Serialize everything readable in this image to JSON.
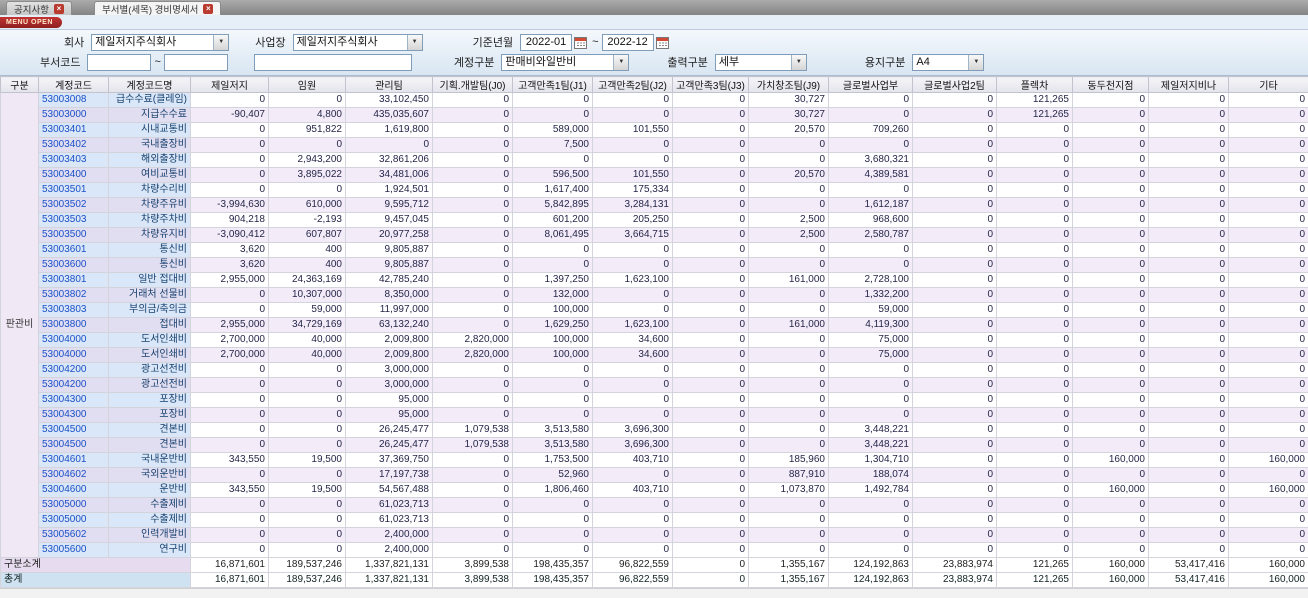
{
  "tabs": [
    {
      "label": "공지사항"
    },
    {
      "label": "부서별(세목) 경비명세서"
    }
  ],
  "menu_open_label": "MENU OPEN",
  "filters": {
    "company_label": "회사",
    "company_value": "제일저지주식회사",
    "site_label": "사업장",
    "site_value": "제일저지주식회사",
    "period_label": "기준년월",
    "period_from": "2022-01",
    "period_to": "2022-12",
    "range_separator": "~",
    "dept_code_label": "부서코드",
    "dept_from": "",
    "dept_to": "",
    "dept_name": "",
    "account_label": "계정구분",
    "account_value": "판매비와일반비",
    "output_label": "출력구분",
    "output_value": "세부",
    "paper_label": "용지구분",
    "paper_value": "A4"
  },
  "icons": {
    "close": "×",
    "dropdown_arrow": "▼",
    "calendar": "calendar-icon"
  },
  "colors": {
    "tab_close_red": "#b93a2e",
    "menu_open_red": "#8e1f1f",
    "code_blue": "#1a50c8",
    "stripe_lavender": "#f3ecf8",
    "code_bg_blue": "#d9e7f8",
    "total_row_blue": "#cfe2f2"
  },
  "table": {
    "group_label": "판관비",
    "headers": [
      "구분",
      "계정코드",
      "계정코드명",
      "제일저지",
      "임원",
      "관리팀",
      "기획.개발팀(J0)",
      "고객만족1팀(J1)",
      "고객만족2팀(J2)",
      "고객만족3팀(J3)",
      "가치창조팀(J9)",
      "글로벌사업부",
      "글로벌사업2팀",
      "플렉차",
      "동두천지점",
      "제일저지비나",
      "기타"
    ],
    "rows": [
      {
        "code": "53003008",
        "name": "급수수료(클레임)",
        "values": [
          "0",
          "0",
          "33,102,450",
          "0",
          "0",
          "0",
          "0",
          "30,727",
          "0",
          "0",
          "121,265",
          "0",
          "0",
          "0"
        ]
      },
      {
        "code": "53003000",
        "name": "지급수수료",
        "values": [
          "-90,407",
          "4,800",
          "435,035,607",
          "0",
          "0",
          "0",
          "0",
          "30,727",
          "0",
          "0",
          "121,265",
          "0",
          "0",
          "0"
        ]
      },
      {
        "code": "53003401",
        "name": "시내교통비",
        "values": [
          "0",
          "951,822",
          "1,619,800",
          "0",
          "589,000",
          "101,550",
          "0",
          "20,570",
          "709,260",
          "0",
          "0",
          "0",
          "0",
          "0"
        ]
      },
      {
        "code": "53003402",
        "name": "국내출장비",
        "values": [
          "0",
          "0",
          "0",
          "0",
          "7,500",
          "0",
          "0",
          "0",
          "0",
          "0",
          "0",
          "0",
          "0",
          "0"
        ]
      },
      {
        "code": "53003403",
        "name": "해외출장비",
        "values": [
          "0",
          "2,943,200",
          "32,861,206",
          "0",
          "0",
          "0",
          "0",
          "0",
          "3,680,321",
          "0",
          "0",
          "0",
          "0",
          "0"
        ]
      },
      {
        "code": "53003400",
        "name": "여비교통비",
        "values": [
          "0",
          "3,895,022",
          "34,481,006",
          "0",
          "596,500",
          "101,550",
          "0",
          "20,570",
          "4,389,581",
          "0",
          "0",
          "0",
          "0",
          "0"
        ]
      },
      {
        "code": "53003501",
        "name": "차량수리비",
        "values": [
          "0",
          "0",
          "1,924,501",
          "0",
          "1,617,400",
          "175,334",
          "0",
          "0",
          "0",
          "0",
          "0",
          "0",
          "0",
          "0"
        ]
      },
      {
        "code": "53003502",
        "name": "차량주유비",
        "values": [
          "-3,994,630",
          "610,000",
          "9,595,712",
          "0",
          "5,842,895",
          "3,284,131",
          "0",
          "0",
          "1,612,187",
          "0",
          "0",
          "0",
          "0",
          "0"
        ]
      },
      {
        "code": "53003503",
        "name": "차량주차비",
        "values": [
          "904,218",
          "-2,193",
          "9,457,045",
          "0",
          "601,200",
          "205,250",
          "0",
          "2,500",
          "968,600",
          "0",
          "0",
          "0",
          "0",
          "0"
        ]
      },
      {
        "code": "53003500",
        "name": "차량유지비",
        "values": [
          "-3,090,412",
          "607,807",
          "20,977,258",
          "0",
          "8,061,495",
          "3,664,715",
          "0",
          "2,500",
          "2,580,787",
          "0",
          "0",
          "0",
          "0",
          "0"
        ]
      },
      {
        "code": "53003601",
        "name": "통신비",
        "values": [
          "3,620",
          "400",
          "9,805,887",
          "0",
          "0",
          "0",
          "0",
          "0",
          "0",
          "0",
          "0",
          "0",
          "0",
          "0"
        ]
      },
      {
        "code": "53003600",
        "name": "통신비",
        "values": [
          "3,620",
          "400",
          "9,805,887",
          "0",
          "0",
          "0",
          "0",
          "0",
          "0",
          "0",
          "0",
          "0",
          "0",
          "0"
        ]
      },
      {
        "code": "53003801",
        "name": "일반 접대비",
        "values": [
          "2,955,000",
          "24,363,169",
          "42,785,240",
          "0",
          "1,397,250",
          "1,623,100",
          "0",
          "161,000",
          "2,728,100",
          "0",
          "0",
          "0",
          "0",
          "0"
        ]
      },
      {
        "code": "53003802",
        "name": "거래처 선물비",
        "values": [
          "0",
          "10,307,000",
          "8,350,000",
          "0",
          "132,000",
          "0",
          "0",
          "0",
          "1,332,200",
          "0",
          "0",
          "0",
          "0",
          "0"
        ]
      },
      {
        "code": "53003803",
        "name": "부의금/축의금",
        "values": [
          "0",
          "59,000",
          "11,997,000",
          "0",
          "100,000",
          "0",
          "0",
          "0",
          "59,000",
          "0",
          "0",
          "0",
          "0",
          "0"
        ]
      },
      {
        "code": "53003800",
        "name": "접대비",
        "values": [
          "2,955,000",
          "34,729,169",
          "63,132,240",
          "0",
          "1,629,250",
          "1,623,100",
          "0",
          "161,000",
          "4,119,300",
          "0",
          "0",
          "0",
          "0",
          "0"
        ]
      },
      {
        "code": "53004000",
        "name": "도서인쇄비",
        "values": [
          "2,700,000",
          "40,000",
          "2,009,800",
          "2,820,000",
          "100,000",
          "34,600",
          "0",
          "0",
          "75,000",
          "0",
          "0",
          "0",
          "0",
          "0"
        ]
      },
      {
        "code": "53004000",
        "name": "도서인쇄비",
        "values": [
          "2,700,000",
          "40,000",
          "2,009,800",
          "2,820,000",
          "100,000",
          "34,600",
          "0",
          "0",
          "75,000",
          "0",
          "0",
          "0",
          "0",
          "0"
        ]
      },
      {
        "code": "53004200",
        "name": "광고선전비",
        "values": [
          "0",
          "0",
          "3,000,000",
          "0",
          "0",
          "0",
          "0",
          "0",
          "0",
          "0",
          "0",
          "0",
          "0",
          "0"
        ]
      },
      {
        "code": "53004200",
        "name": "광고선전비",
        "values": [
          "0",
          "0",
          "3,000,000",
          "0",
          "0",
          "0",
          "0",
          "0",
          "0",
          "0",
          "0",
          "0",
          "0",
          "0"
        ]
      },
      {
        "code": "53004300",
        "name": "포장비",
        "values": [
          "0",
          "0",
          "95,000",
          "0",
          "0",
          "0",
          "0",
          "0",
          "0",
          "0",
          "0",
          "0",
          "0",
          "0"
        ]
      },
      {
        "code": "53004300",
        "name": "포장비",
        "values": [
          "0",
          "0",
          "95,000",
          "0",
          "0",
          "0",
          "0",
          "0",
          "0",
          "0",
          "0",
          "0",
          "0",
          "0"
        ]
      },
      {
        "code": "53004500",
        "name": "견본비",
        "values": [
          "0",
          "0",
          "26,245,477",
          "1,079,538",
          "3,513,580",
          "3,696,300",
          "0",
          "0",
          "3,448,221",
          "0",
          "0",
          "0",
          "0",
          "0"
        ]
      },
      {
        "code": "53004500",
        "name": "견본비",
        "values": [
          "0",
          "0",
          "26,245,477",
          "1,079,538",
          "3,513,580",
          "3,696,300",
          "0",
          "0",
          "3,448,221",
          "0",
          "0",
          "0",
          "0",
          "0"
        ]
      },
      {
        "code": "53004601",
        "name": "국내운반비",
        "values": [
          "343,550",
          "19,500",
          "37,369,750",
          "0",
          "1,753,500",
          "403,710",
          "0",
          "185,960",
          "1,304,710",
          "0",
          "0",
          "160,000",
          "0",
          "160,000"
        ]
      },
      {
        "code": "53004602",
        "name": "국외운반비",
        "values": [
          "0",
          "0",
          "17,197,738",
          "0",
          "52,960",
          "0",
          "0",
          "887,910",
          "188,074",
          "0",
          "0",
          "0",
          "0",
          "0"
        ]
      },
      {
        "code": "53004600",
        "name": "운반비",
        "values": [
          "343,550",
          "19,500",
          "54,567,488",
          "0",
          "1,806,460",
          "403,710",
          "0",
          "1,073,870",
          "1,492,784",
          "0",
          "0",
          "160,000",
          "0",
          "160,000"
        ]
      },
      {
        "code": "53005000",
        "name": "수출제비",
        "values": [
          "0",
          "0",
          "61,023,713",
          "0",
          "0",
          "0",
          "0",
          "0",
          "0",
          "0",
          "0",
          "0",
          "0",
          "0"
        ]
      },
      {
        "code": "53005000",
        "name": "수출제비",
        "values": [
          "0",
          "0",
          "61,023,713",
          "0",
          "0",
          "0",
          "0",
          "0",
          "0",
          "0",
          "0",
          "0",
          "0",
          "0"
        ]
      },
      {
        "code": "53005602",
        "name": "인력개발비",
        "values": [
          "0",
          "0",
          "2,400,000",
          "0",
          "0",
          "0",
          "0",
          "0",
          "0",
          "0",
          "0",
          "0",
          "0",
          "0"
        ]
      },
      {
        "code": "53005600",
        "name": "연구비",
        "values": [
          "0",
          "0",
          "2,400,000",
          "0",
          "0",
          "0",
          "0",
          "0",
          "0",
          "0",
          "0",
          "0",
          "0",
          "0"
        ]
      }
    ],
    "subtotal": {
      "label": "구분소계",
      "values": [
        "16,871,601",
        "189,537,246",
        "1,337,821,131",
        "3,899,538",
        "198,435,357",
        "96,822,559",
        "0",
        "1,355,167",
        "124,192,863",
        "23,883,974",
        "121,265",
        "160,000",
        "53,417,416",
        "160,000"
      ]
    },
    "total": {
      "label": "총계",
      "values": [
        "16,871,601",
        "189,537,246",
        "1,337,821,131",
        "3,899,538",
        "198,435,357",
        "96,822,559",
        "0",
        "1,355,167",
        "124,192,863",
        "23,883,974",
        "121,265",
        "160,000",
        "53,417,416",
        "160,000"
      ]
    }
  }
}
